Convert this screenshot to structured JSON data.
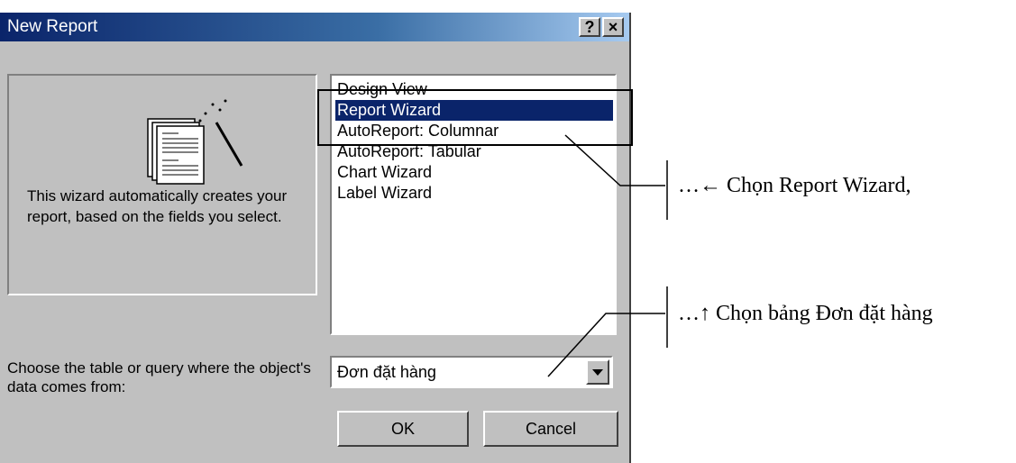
{
  "dialog": {
    "title": "New Report",
    "help_button": "?",
    "close_button": "×"
  },
  "preview": {
    "description": "This wizard automatically creates your report, based on the fields you select."
  },
  "report_types": [
    "Design View",
    "Report Wizard",
    "AutoReport: Columnar",
    "AutoReport: Tabular",
    "Chart Wizard",
    "Label Wizard"
  ],
  "selected_report_type": "Report Wizard",
  "source": {
    "prompt": "Choose the table or query where the object's data comes from:",
    "value": "Đơn đặt hàng"
  },
  "buttons": {
    "ok": "OK",
    "cancel": "Cancel"
  },
  "annotations": {
    "select_wizard": "…← Chọn Report Wizard,",
    "select_table": "…↑ Chọn bảng Đơn đặt hàng"
  },
  "colors": {
    "dialog_face": "#c0c0c0",
    "title_start": "#0a246a",
    "selection": "#0a246a"
  }
}
